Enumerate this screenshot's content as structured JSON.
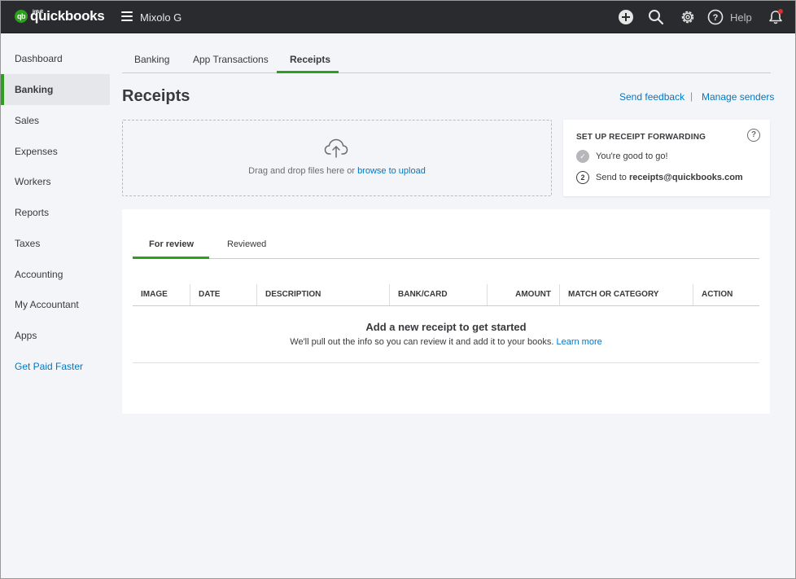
{
  "app": {
    "logo_mark": "qb",
    "logo_brand": "intuit",
    "logo_name": "quickbooks",
    "company": "Mixolo G",
    "help_label": "Help"
  },
  "icons": {
    "add": "plus-circle-icon",
    "search": "search-icon",
    "settings": "gear-icon",
    "help": "question-circle-icon",
    "notifications": "bell-icon"
  },
  "colors": {
    "accent": "#2ca01c",
    "link": "#0077c5",
    "topbar": "#2a2b2e"
  },
  "sidebar": {
    "items": [
      {
        "label": "Dashboard"
      },
      {
        "label": "Banking"
      },
      {
        "label": "Sales"
      },
      {
        "label": "Expenses"
      },
      {
        "label": "Workers"
      },
      {
        "label": "Reports"
      },
      {
        "label": "Taxes"
      },
      {
        "label": "Accounting"
      },
      {
        "label": "My Accountant"
      },
      {
        "label": "Apps"
      },
      {
        "label": "Get Paid Faster"
      }
    ],
    "active": "Banking"
  },
  "subtabs": [
    {
      "label": "Banking"
    },
    {
      "label": "App Transactions"
    },
    {
      "label": "Receipts"
    }
  ],
  "page": {
    "title": "Receipts",
    "send_feedback": "Send feedback",
    "separator": "|",
    "manage_senders": "Manage senders"
  },
  "upload": {
    "text": "Drag and drop files here or ",
    "link": "browse to upload"
  },
  "forwarding": {
    "title": "SET UP RECEIPT FORWARDING",
    "help": "?",
    "step1": "You're good to go!",
    "step2_num": "2",
    "step2_prefix": "Send to ",
    "step2_email": "receipts@quickbooks.com"
  },
  "review_tabs": [
    {
      "label": "For review"
    },
    {
      "label": "Reviewed"
    }
  ],
  "table": {
    "columns": [
      "IMAGE",
      "DATE",
      "DESCRIPTION",
      "BANK/CARD",
      "AMOUNT",
      "MATCH OR CATEGORY",
      "ACTION"
    ]
  },
  "empty": {
    "title": "Add a new receipt to get started",
    "subtitle": "We'll pull out the info so you can review it and add it to your books. ",
    "learn_more": "Learn more"
  }
}
